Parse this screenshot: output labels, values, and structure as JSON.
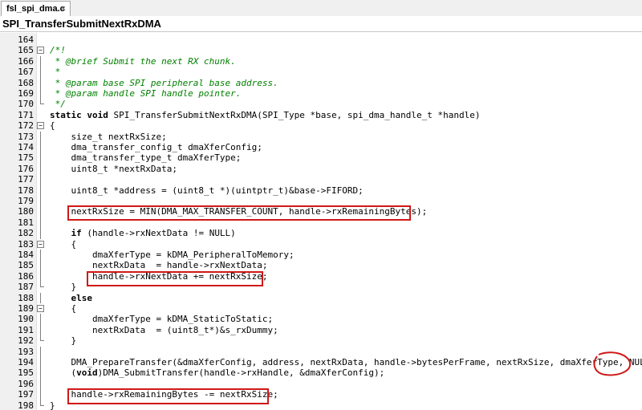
{
  "tab": {
    "label": "fsl_spi_dma.c",
    "close": "×"
  },
  "function_bar": {
    "label": "SPI_TransferSubmitNextRxDMA"
  },
  "lines": [
    {
      "n": "164",
      "fold": "",
      "segs": []
    },
    {
      "n": "165",
      "fold": "open",
      "segs": [
        {
          "t": "/*!",
          "c": "cmt"
        }
      ]
    },
    {
      "n": "166",
      "fold": "bar",
      "segs": [
        {
          "t": " * @brief Submit the next RX chunk.",
          "c": "cmt"
        }
      ]
    },
    {
      "n": "167",
      "fold": "bar",
      "segs": [
        {
          "t": " *",
          "c": "cmt"
        }
      ]
    },
    {
      "n": "168",
      "fold": "bar",
      "segs": [
        {
          "t": " * @param base SPI peripheral base address.",
          "c": "cmt"
        }
      ]
    },
    {
      "n": "169",
      "fold": "bar",
      "segs": [
        {
          "t": " * @param handle SPI handle pointer.",
          "c": "cmt"
        }
      ]
    },
    {
      "n": "170",
      "fold": "end",
      "segs": [
        {
          "t": " */",
          "c": "cmt"
        }
      ]
    },
    {
      "n": "171",
      "fold": "",
      "segs": [
        {
          "t": "static void",
          "c": "kw"
        },
        {
          "t": " SPI_TransferSubmitNextRxDMA(SPI_Type *base, spi_dma_handle_t *handle)",
          "c": ""
        }
      ]
    },
    {
      "n": "172",
      "fold": "open",
      "segs": [
        {
          "t": "{",
          "c": ""
        }
      ]
    },
    {
      "n": "173",
      "fold": "bar",
      "segs": [
        {
          "t": "    size_t nextRxSize;",
          "c": ""
        }
      ]
    },
    {
      "n": "174",
      "fold": "bar",
      "segs": [
        {
          "t": "    dma_transfer_config_t dmaXferConfig;",
          "c": ""
        }
      ]
    },
    {
      "n": "175",
      "fold": "bar",
      "segs": [
        {
          "t": "    dma_transfer_type_t dmaXferType;",
          "c": ""
        }
      ]
    },
    {
      "n": "176",
      "fold": "bar",
      "segs": [
        {
          "t": "    uint8_t *nextRxData;",
          "c": ""
        }
      ]
    },
    {
      "n": "177",
      "fold": "bar",
      "segs": []
    },
    {
      "n": "178",
      "fold": "bar",
      "segs": [
        {
          "t": "    uint8_t *address = (uint8_t *)(uintptr_t)&base->FIFORD;",
          "c": ""
        }
      ]
    },
    {
      "n": "179",
      "fold": "bar",
      "segs": []
    },
    {
      "n": "180",
      "fold": "bar",
      "segs": [
        {
          "t": "    nextRxSize = MIN(DMA_MAX_TRANSFER_COUNT, handle->rxRemainingBytes);",
          "c": ""
        }
      ]
    },
    {
      "n": "181",
      "fold": "bar",
      "segs": []
    },
    {
      "n": "182",
      "fold": "bar",
      "segs": [
        {
          "t": "    ",
          "c": ""
        },
        {
          "t": "if",
          "c": "kw"
        },
        {
          "t": " (handle->rxNextData != NULL)",
          "c": ""
        }
      ]
    },
    {
      "n": "183",
      "fold": "open",
      "segs": [
        {
          "t": "    {",
          "c": ""
        }
      ]
    },
    {
      "n": "184",
      "fold": "bar",
      "segs": [
        {
          "t": "        dmaXferType = kDMA_PeripheralToMemory;",
          "c": ""
        }
      ]
    },
    {
      "n": "185",
      "fold": "bar",
      "segs": [
        {
          "t": "        nextRxData  = handle->rxNextData;",
          "c": ""
        }
      ]
    },
    {
      "n": "186",
      "fold": "bar",
      "segs": [
        {
          "t": "        handle->rxNextData += nextRxSize;",
          "c": ""
        }
      ]
    },
    {
      "n": "187",
      "fold": "end",
      "segs": [
        {
          "t": "    }",
          "c": ""
        }
      ]
    },
    {
      "n": "188",
      "fold": "bar",
      "segs": [
        {
          "t": "    ",
          "c": ""
        },
        {
          "t": "else",
          "c": "kw"
        }
      ]
    },
    {
      "n": "189",
      "fold": "open",
      "segs": [
        {
          "t": "    {",
          "c": ""
        }
      ]
    },
    {
      "n": "190",
      "fold": "bar",
      "segs": [
        {
          "t": "        dmaXferType = kDMA_StaticToStatic;",
          "c": ""
        }
      ]
    },
    {
      "n": "191",
      "fold": "bar",
      "segs": [
        {
          "t": "        nextRxData  = (uint8_t*)&s_rxDummy;",
          "c": ""
        }
      ]
    },
    {
      "n": "192",
      "fold": "end",
      "segs": [
        {
          "t": "    }",
          "c": ""
        }
      ]
    },
    {
      "n": "193",
      "fold": "bar",
      "segs": []
    },
    {
      "n": "194",
      "fold": "bar",
      "segs": [
        {
          "t": "    DMA_PrepareTransfer(&dmaXferConfig, address, nextRxData, handle->bytesPerFrame, nextRxSize, dmaXferType, NULL);",
          "c": ""
        }
      ]
    },
    {
      "n": "195",
      "fold": "bar",
      "segs": [
        {
          "t": "    (",
          "c": ""
        },
        {
          "t": "void",
          "c": "kw"
        },
        {
          "t": ")DMA_SubmitTransfer(handle->rxHandle, &dmaXferConfig);",
          "c": ""
        }
      ]
    },
    {
      "n": "196",
      "fold": "bar",
      "segs": []
    },
    {
      "n": "197",
      "fold": "bar",
      "segs": [
        {
          "t": "    handle->rxRemainingBytes -= nextRxSize;",
          "c": ""
        }
      ]
    },
    {
      "n": "198",
      "fold": "end",
      "segs": [
        {
          "t": "}",
          "c": ""
        }
      ]
    }
  ],
  "colors": {
    "comment": "#008000",
    "highlight": "#d01818",
    "gutter": "#f0f0f0"
  }
}
